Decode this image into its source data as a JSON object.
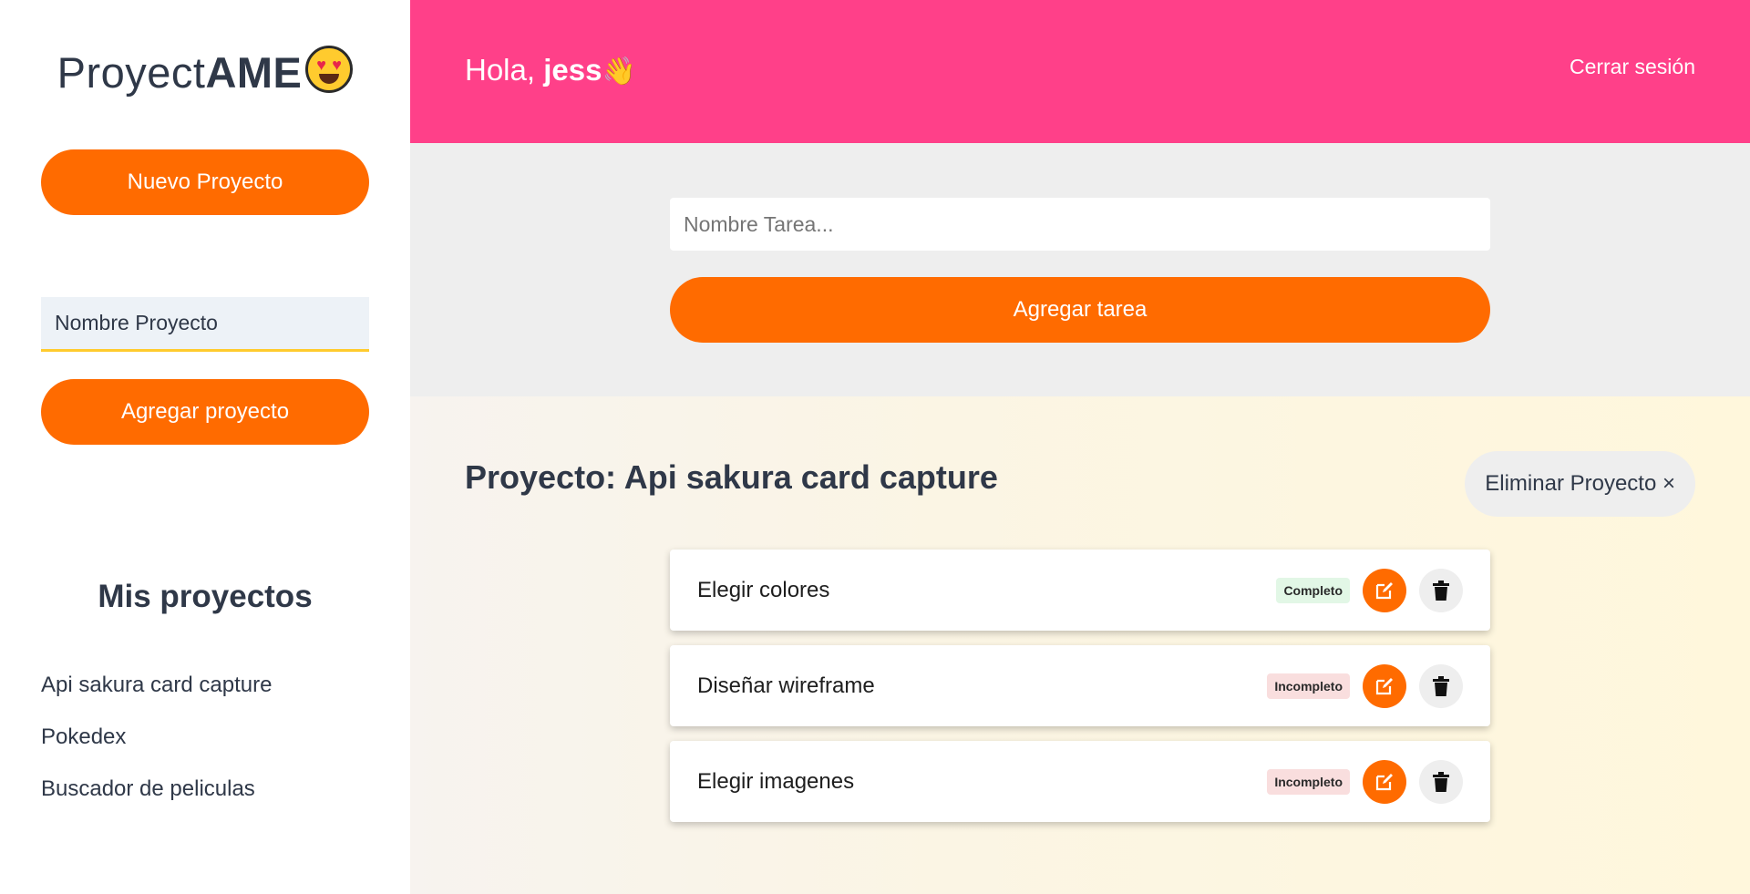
{
  "brand": {
    "light": "Proyect",
    "bold": "AME",
    "emoji_icon": "heart-eyes-emoji-icon"
  },
  "sidebar": {
    "new_project_label": "Nuevo Proyecto",
    "project_input_value": "Nombre Proyecto",
    "add_project_label": "Agregar proyecto",
    "my_projects_title": "Mis proyectos",
    "projects": [
      "Api sakura card capture",
      "Pokedex",
      "Buscador de peliculas"
    ]
  },
  "header": {
    "greeting_prefix": "Hola,",
    "user_name": "jess",
    "wave_icon": "waving-hand-icon",
    "logout_label": "Cerrar sesión"
  },
  "task_form": {
    "placeholder": "Nombre Tarea...",
    "add_task_label": "Agregar tarea"
  },
  "project": {
    "title": "Proyecto: Api sakura card capture",
    "delete_label": "Eliminar Proyecto ×",
    "tasks": [
      {
        "name": "Elegir colores",
        "status": "Completo"
      },
      {
        "name": "Diseñar wireframe",
        "status": "Incompleto"
      },
      {
        "name": "Elegir imagenes",
        "status": "Incompleto"
      }
    ]
  },
  "colors": {
    "accent": "#ff6b00",
    "header": "#ff4089",
    "complete_badge": "#e2f7e6",
    "incomplete_badge": "#f9dede",
    "input_underline": "#ffcb2e"
  }
}
